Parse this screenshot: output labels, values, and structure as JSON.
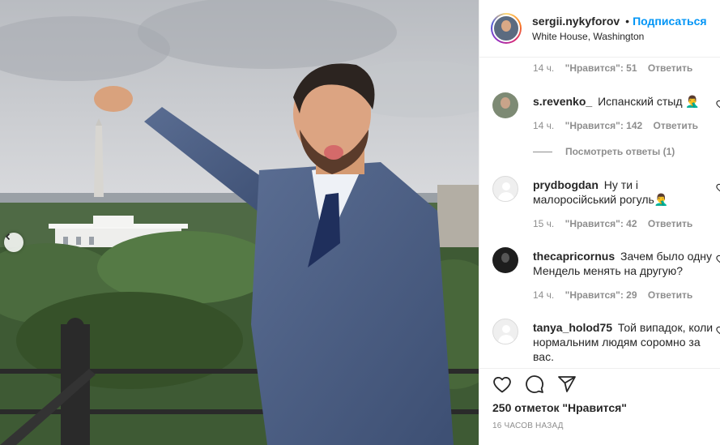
{
  "header": {
    "username": "sergii.nykyforov",
    "separator": "•",
    "follow_label": "Подписаться",
    "location": "White House, Washington"
  },
  "comments": [
    {
      "username": "",
      "text": "",
      "time": "14 ч.",
      "likes": "\"Нравится\": 51",
      "reply_label": "Ответить"
    },
    {
      "username": "s.revenko_",
      "text": "Испанский стыд 🤦‍♂️",
      "time": "14 ч.",
      "likes": "\"Нравится\": 142",
      "reply_label": "Ответить",
      "view_replies": "Посмотреть ответы (1)"
    },
    {
      "username": "prydbogdan",
      "text": "Ну ти і малоросійський рогуль🤦‍♂️",
      "time": "15 ч.",
      "likes": "\"Нравится\": 42",
      "reply_label": "Ответить"
    },
    {
      "username": "thecapricornus",
      "text": "Зачем было одну Мендель менять на другую?",
      "time": "14 ч.",
      "likes": "\"Нравится\": 29",
      "reply_label": "Ответить"
    },
    {
      "username": "tanya_holod75",
      "text": "Той випадок, коли нормальним людям соромно за вас.",
      "time": "",
      "likes": "",
      "reply_label": ""
    }
  ],
  "actions": {
    "like_count": "250 отметок \"Нравится\"",
    "timestamp": "16 часов назад"
  },
  "colors": {
    "link_blue": "#0095f6",
    "secondary_text": "#8e8e8e",
    "border": "#efefef"
  },
  "icons": [
    "heart-icon",
    "comment-icon",
    "share-icon",
    "chevron-left-icon"
  ]
}
